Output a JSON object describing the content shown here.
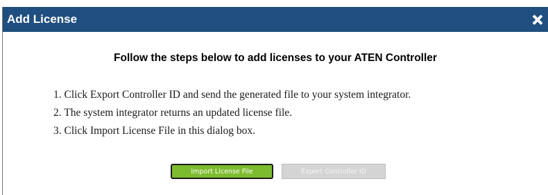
{
  "dialog": {
    "title": "Add License",
    "close_icon": "close-icon",
    "heading": "Follow the steps below to add licenses to your ATEN Controller",
    "steps": [
      "1. Click Export Controller ID and send the generated file to your system integrator.",
      "2. The system integrator returns an updated license file.",
      "3. Click Import License File in this dialog box."
    ],
    "buttons": {
      "import_label": "Import License File",
      "export_label": "Export Controller ID"
    }
  },
  "colors": {
    "titlebar": "#1f4f7e",
    "import_button": "#7dbb2f",
    "export_button_disabled": "#d4d4d4"
  }
}
